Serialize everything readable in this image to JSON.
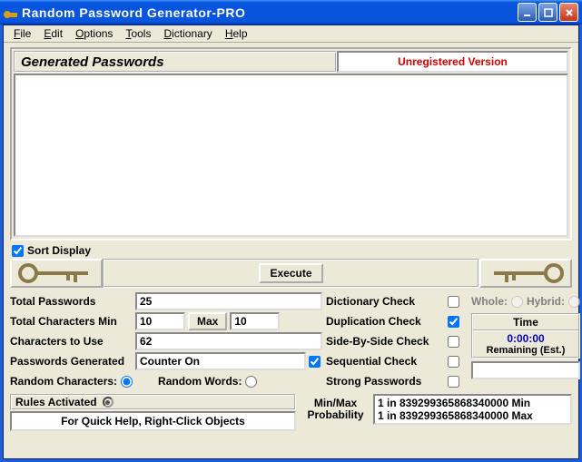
{
  "window": {
    "title": "Random Password Generator-PRO"
  },
  "menu": {
    "file": "File",
    "edit": "Edit",
    "options": "Options",
    "tools": "Tools",
    "dictionary": "Dictionary",
    "help": "Help"
  },
  "header": {
    "title": "Generated Passwords",
    "status": "Unregistered Version"
  },
  "sort": {
    "label": "Sort Display"
  },
  "execute": {
    "label": "Execute"
  },
  "fields": {
    "total_passwords": {
      "label": "Total Passwords",
      "value": "25"
    },
    "total_chars_min": {
      "label": "Total Characters Min",
      "value": "10",
      "max_btn": "Max",
      "max_value": "10"
    },
    "chars_to_use": {
      "label": "Characters to Use",
      "value": "62"
    },
    "pwds_generated": {
      "label": "Passwords Generated",
      "value": "Counter On"
    },
    "random_chars": {
      "label": "Random Characters:"
    },
    "random_words": {
      "label": "Random Words:"
    }
  },
  "checks": {
    "dictionary": {
      "label": "Dictionary Check"
    },
    "duplication": {
      "label": "Duplication Check"
    },
    "sidebyside": {
      "label": "Side-By-Side Check"
    },
    "sequential": {
      "label": "Sequential Check"
    },
    "strong": {
      "label": "Strong Passwords"
    }
  },
  "modes": {
    "whole": "Whole:",
    "hybrid": "Hybrid:"
  },
  "time": {
    "header": "Time",
    "value": "0:00:00",
    "remaining": "Remaining (Est.)"
  },
  "rules": {
    "label": "Rules Activated",
    "hint": "For Quick Help, Right-Click Objects"
  },
  "prob": {
    "label": "Min/Max Probability",
    "min": "1 in 839299365868340000 Min",
    "max": "1 in 839299365868340000 Max"
  }
}
